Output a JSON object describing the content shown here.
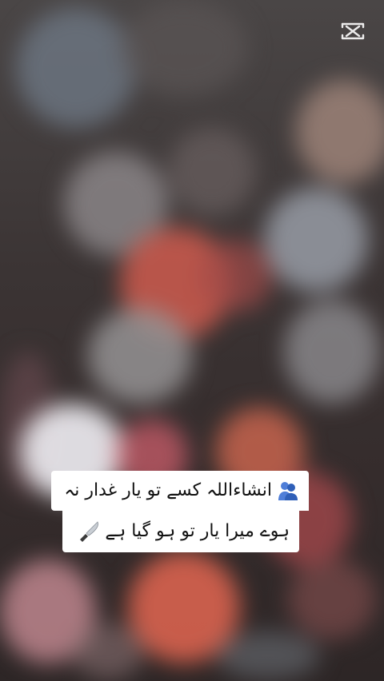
{
  "caption": {
    "line1": "انشاءاللہ کسے تو یار غدار نہ",
    "line2": "ہوے میرا یار تو ہو گیا ہے"
  },
  "icons": {
    "line1_emoji": "people-hugging-icon",
    "line2_emoji": "knife-icon",
    "watermark": "capcut-logo-icon"
  },
  "colors": {
    "caption_background": "#ffffff",
    "caption_text": "#111111"
  }
}
